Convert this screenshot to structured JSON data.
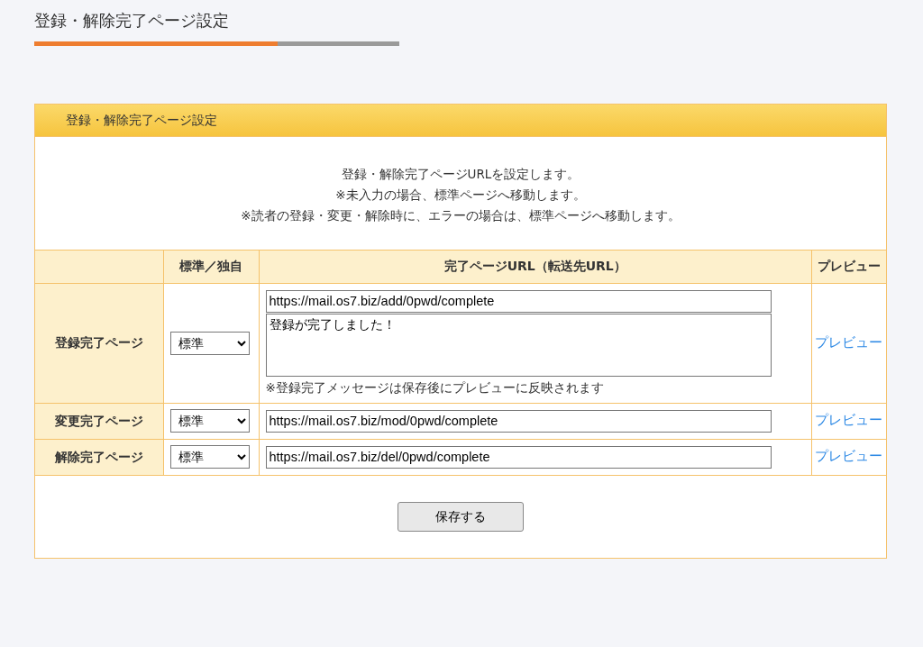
{
  "page_title": "登録・解除完了ページ設定",
  "progress": {
    "level": 0.667
  },
  "panel": {
    "title": "登録・解除完了ページ設定",
    "description": [
      "登録・解除完了ページURLを設定します。",
      "※未入力の場合、標準ページへ移動します。",
      "※読者の登録・変更・解除時に、エラーの場合は、標準ページへ移動します。"
    ],
    "columns": [
      "",
      "標準／独自",
      "完了ページURL（転送先URL）",
      "プレビュー"
    ],
    "rows": [
      {
        "label": "登録完了ページ",
        "mode": "標準",
        "url": "https://mail.os7.biz/add/0pwd/complete",
        "message": "登録が完了しました！",
        "note": "※登録完了メッセージは保存後にプレビューに反映されます",
        "preview": "プレビュー"
      },
      {
        "label": "変更完了ページ",
        "mode": "標準",
        "url": "https://mail.os7.biz/mod/0pwd/complete",
        "preview": "プレビュー"
      },
      {
        "label": "解除完了ページ",
        "mode": "標準",
        "url": "https://mail.os7.biz/del/0pwd/complete",
        "preview": "プレビュー"
      }
    ],
    "save_button": "保存する"
  }
}
